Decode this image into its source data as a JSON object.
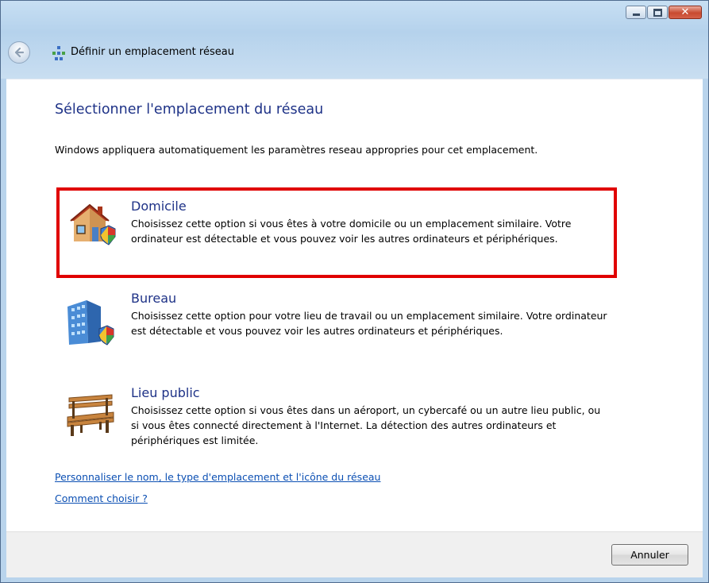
{
  "window": {
    "title": "Définir un emplacement réseau"
  },
  "main": {
    "heading": "Sélectionner l'emplacement du réseau",
    "description": "Windows appliquera automatiquement les paramètres reseau appropries pour cet emplacement."
  },
  "options": [
    {
      "title": "Domicile",
      "description": "Choisissez cette option si vous êtes à votre domicile ou un emplacement similaire. Votre ordinateur est détectable et vous pouvez voir les autres ordinateurs et périphériques.",
      "icon": "house-icon",
      "highlighted": true
    },
    {
      "title": "Bureau",
      "description": "Choisissez cette option pour votre lieu de travail ou un emplacement similaire. Votre ordinateur est détectable et vous pouvez voir les autres ordinateurs et périphériques.",
      "icon": "office-building-icon",
      "highlighted": false
    },
    {
      "title": "Lieu public",
      "description": "Choisissez cette option si vous êtes dans un aéroport, un cybercafé ou un autre lieu public, ou si vous êtes connecté directement à l'Internet. La détection des autres ordinateurs et périphériques est limitée.",
      "icon": "park-bench-icon",
      "highlighted": false
    }
  ],
  "links": {
    "customize": "Personnaliser le nom, le type d'emplacement et l'icône du réseau",
    "how_to_choose": "Comment choisir ?"
  },
  "footer": {
    "cancel_label": "Annuler"
  },
  "colors": {
    "heading": "#1e3287",
    "link": "#0b4fb3",
    "highlight_border": "#e00000",
    "frame": "#b9d4ec"
  }
}
